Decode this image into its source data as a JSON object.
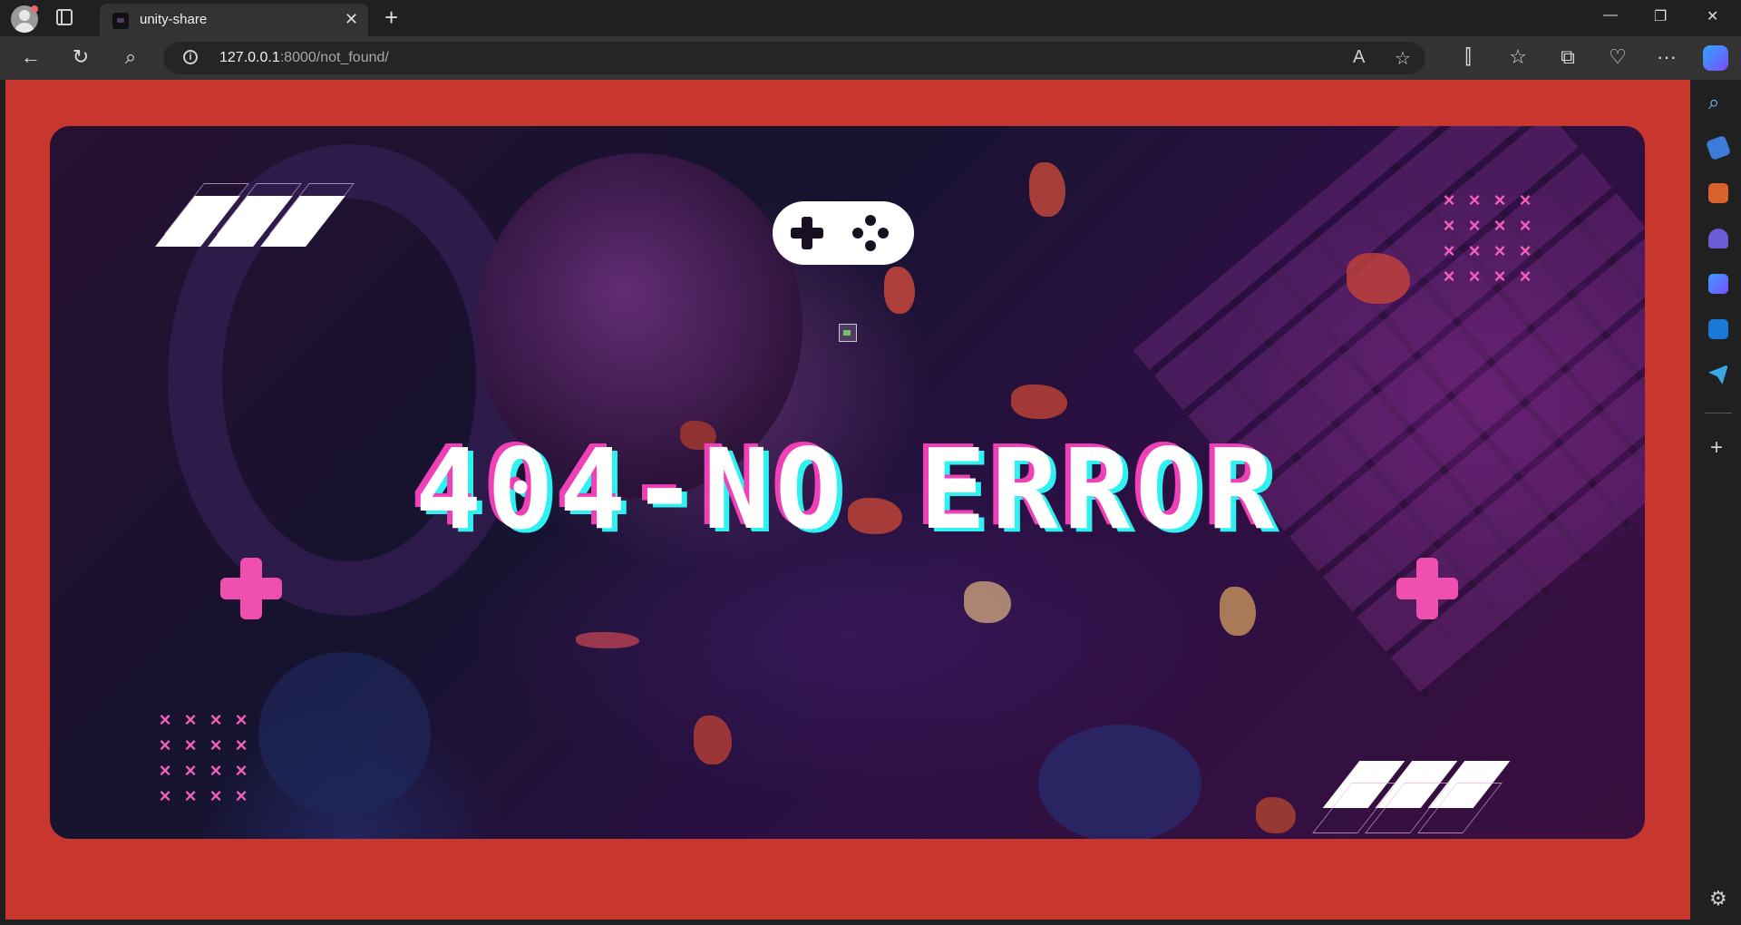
{
  "browser": {
    "tab": {
      "title": "unity-share",
      "close_glyph": "✕"
    },
    "new_tab_glyph": "+",
    "window_buttons": {
      "minimize": "—",
      "restore": "❐",
      "close": "✕"
    },
    "toolbar": {
      "back": "←",
      "reload": "↻",
      "search": "⌕",
      "split": "⫿",
      "favorites": "☆",
      "collections": "⧉",
      "health": "♡",
      "more": "···"
    },
    "address_bar": {
      "url_host": "127.0.0.1",
      "url_rest": ":8000/not_found/",
      "read_aloud": "A",
      "favorite": "☆"
    },
    "sidebar_icons": [
      "search-icon",
      "shopping-tag-icon",
      "toolbox-icon",
      "games-icon",
      "microsoft-365-icon",
      "outlook-icon",
      "send-icon",
      "add-icon",
      "settings-icon"
    ],
    "sidebar_glyphs": {
      "search": "⌕",
      "add": "+",
      "settings": "⚙"
    }
  },
  "page": {
    "background_color": "#c8372d",
    "headline": "404-NO ERROR",
    "x_marks": [
      "×",
      "×",
      "×",
      "×",
      "×",
      "×",
      "×",
      "×",
      "×",
      "×",
      "×",
      "×",
      "×",
      "×",
      "×",
      "×"
    ],
    "accent_colors": {
      "pink": "#f040b8",
      "cyan": "#2ff1f1",
      "marks": "#ef4fae"
    }
  }
}
